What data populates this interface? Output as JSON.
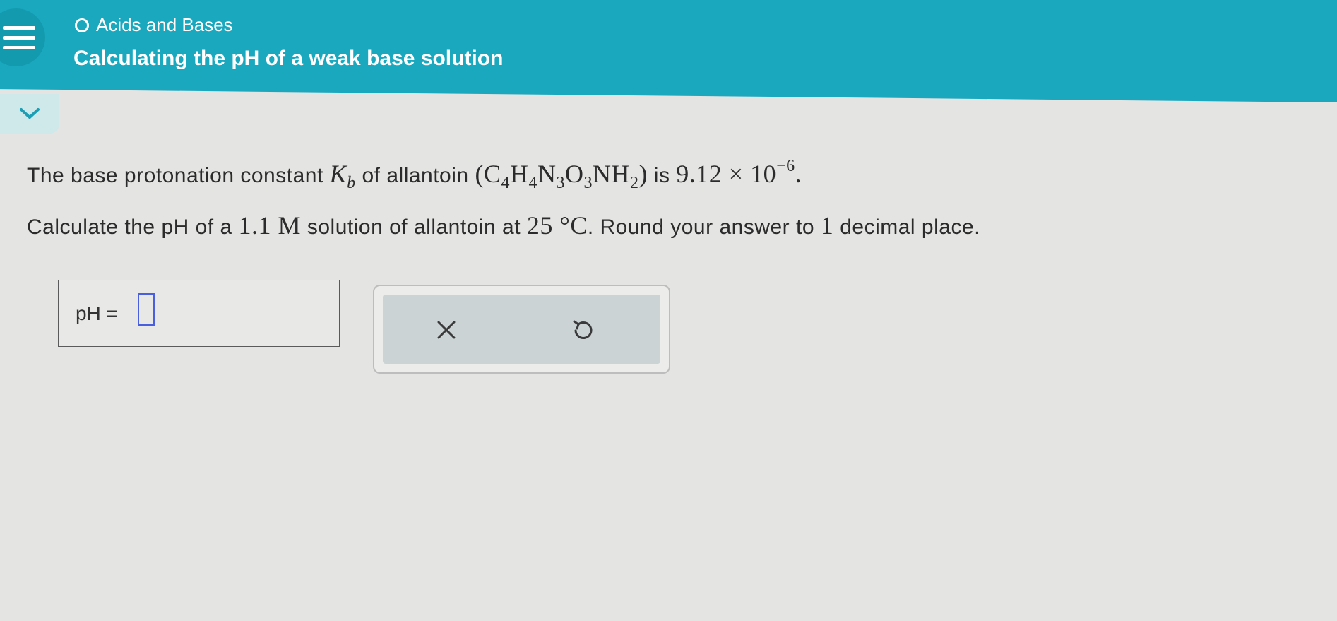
{
  "header": {
    "topic": "Acids and Bases",
    "title": "Calculating the pH of a weak base solution"
  },
  "problem": {
    "line1_prefix": "The base protonation constant",
    "kb_symbol": "K",
    "kb_subscript": "b",
    "line1_of": "of allantoin",
    "formula": {
      "open": "(C",
      "c_sub": "4",
      "h": "H",
      "h_sub": "4",
      "n": "N",
      "n_sub": "3",
      "o": "O",
      "o_sub": "3",
      "nh": "NH",
      "nh_sub": "2",
      "close": ")"
    },
    "line1_is": "is",
    "kb_mantissa": "9.12 × 10",
    "kb_exponent": "−6",
    "line1_end": ".",
    "line2_prefix": "Calculate the pH of a",
    "concentration": "1.1 M",
    "line2_mid": "solution of allantoin at",
    "temperature": "25 °C",
    "line2_round": ". Round your answer to",
    "decimals": "1",
    "line2_end": "decimal place."
  },
  "answer": {
    "label": "pH =",
    "value": ""
  },
  "colors": {
    "header": "#1aa8bf",
    "background": "#e4e4e2",
    "input_border": "#4a5fe0",
    "tool_panel": "#cbd3d5"
  },
  "icons": {
    "menu": "hamburger-icon",
    "topic": "circle-outline-icon",
    "collapse": "chevron-down-icon",
    "clear": "x-icon",
    "undo": "undo-icon"
  }
}
